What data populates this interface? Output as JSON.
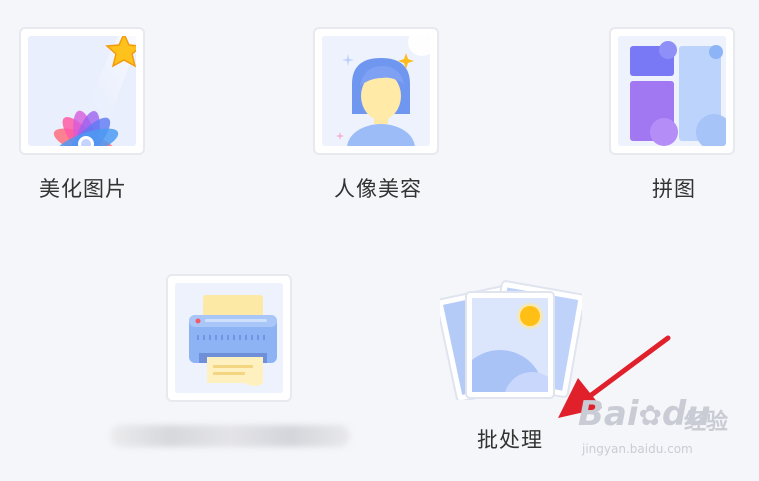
{
  "tools": [
    {
      "id": "beautify",
      "label": "美化图片",
      "icon": "flower-star-icon"
    },
    {
      "id": "portrait",
      "label": "人像美容",
      "icon": "portrait-icon"
    },
    {
      "id": "collage",
      "label": "拼图",
      "icon": "collage-icon"
    },
    {
      "id": "print",
      "label": "",
      "icon": "printer-icon"
    },
    {
      "id": "batch",
      "label": "批处理",
      "icon": "photo-stack-icon"
    }
  ],
  "watermark": {
    "brand_a": "Bai",
    "brand_b": "du",
    "brand_c": "经验",
    "url": "jingyan.baidu.com"
  },
  "colors": {
    "background": "#f5f6fa",
    "arrow": "#e0202b",
    "accent_blue": "#5b8cff"
  }
}
